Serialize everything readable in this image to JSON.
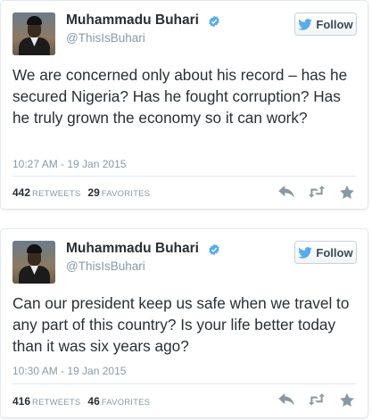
{
  "tweets": [
    {
      "name": "Muhammadu Buhari",
      "handle": "@ThisIsBuhari",
      "follow_label": "Follow",
      "text": "We are concerned only about his record – has he secured Nigeria? Has he fought corruption? Has he truly grown the economy so it can work?",
      "time": "10:27 AM - 19 Jan 2015",
      "retweets": "442",
      "retweets_label": "RETWEETS",
      "favorites": "29",
      "favorites_label": "FAVORITES"
    },
    {
      "name": "Muhammadu Buhari",
      "handle": "@ThisIsBuhari",
      "follow_label": "Follow",
      "text": "Can our president keep us safe when we travel to any part of this country? Is your life better today than it was six years ago?",
      "time": "10:30 AM - 19 Jan 2015",
      "retweets": "416",
      "retweets_label": "RETWEETS",
      "favorites": "46",
      "favorites_label": "FAVORITES"
    }
  ],
  "colors": {
    "verified": "#55acee",
    "follow_bird": "#55acee",
    "muted": "#8899a6",
    "text": "#292f33"
  },
  "icons": [
    "verified-badge-icon",
    "twitter-bird-icon",
    "reply-icon",
    "retweet-icon",
    "favorite-star-icon"
  ]
}
